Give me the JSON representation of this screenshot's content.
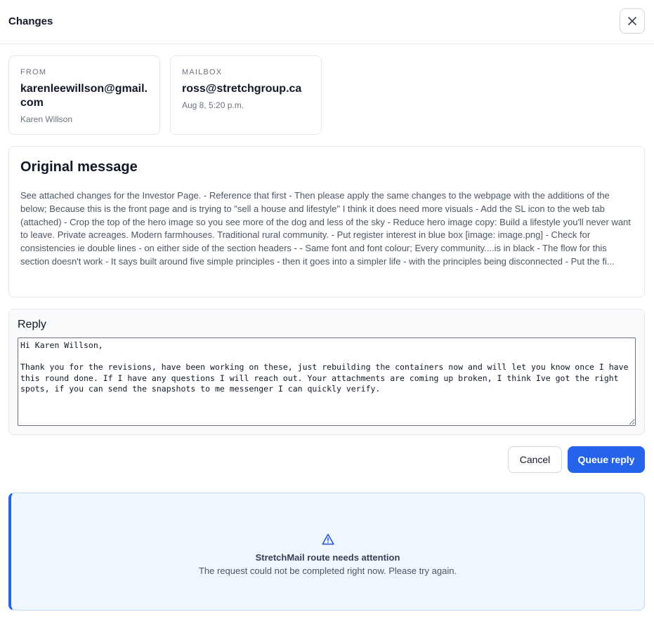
{
  "header": {
    "title": "Changes",
    "close_icon": "close-icon"
  },
  "from": {
    "label": "FROM",
    "email": "karenleewillson@gmail.com",
    "name": "Karen Willson"
  },
  "mailbox": {
    "label": "MAILBOX",
    "email": "ross@stretchgroup.ca",
    "date": "Aug 8, 5:20 p.m."
  },
  "original": {
    "title": "Original message",
    "body": "See attached changes for the Investor Page. - Reference that first - Then please apply the same changes to the webpage with the additions of the below; Because this is the front page and is trying to \"sell a house and lifestyle\" I think it does need more visuals - Add the SL icon to the web tab (attached) - Crop the top of the hero image so you see more of the dog and less of the sky - Reduce hero image copy: Build a lifestyle you'll never want to leave. Private acreages. Modern farmhouses. Traditional rural community. - Put register interest in blue box [image: image.png] - Check for consistencies ie double lines - on either side of the section headers - - Same font and font colour; Every community....is in black - The flow for this section doesn't work - It says built around five simple principles - then it goes into a simpler life - with the principles being disconnected - Put the fi..."
  },
  "reply": {
    "label": "Reply",
    "value": "Hi Karen Willson,\n\nThank you for the revisions, have been working on these, just rebuilding the containers now and will let you know once I have this round done. If I have any questions I will reach out. Your attachments are coming up broken, I think Ive got the right spots, if you can send the snapshots to me messenger I can quickly verify."
  },
  "actions": {
    "cancel_label": "Cancel",
    "queue_label": "Queue reply"
  },
  "alert": {
    "icon": "warning-icon",
    "title": "StretchMail route needs attention",
    "message": "The request could not be completed right now. Please try again."
  },
  "colors": {
    "accent": "#2563eb",
    "alert_bg": "#eff6ff"
  }
}
